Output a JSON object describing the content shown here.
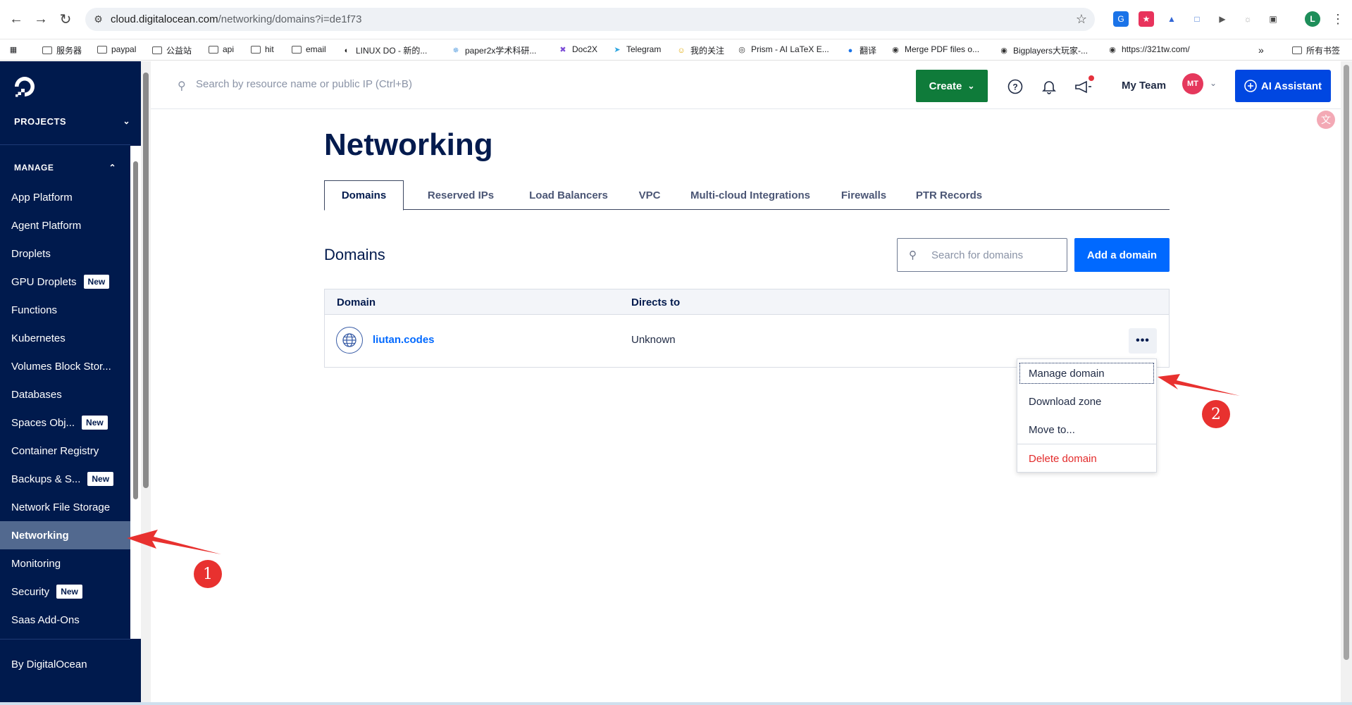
{
  "browser": {
    "url_host": "cloud.digitalocean.com",
    "url_path": "/networking/domains?i=de1f73",
    "bookmarks": [
      "服务器",
      "paypal",
      "公益站",
      "api",
      "hit",
      "email",
      "LINUX DO - 新的...",
      "paper2x学术科研...",
      "Doc2X",
      "Telegram",
      "我的关注",
      "Prism - AI LaTeX E...",
      "翻译",
      "Merge PDF files o...",
      "Bigplayers大玩家-...",
      "https://321tw.com/"
    ],
    "all_bookmarks": "所有书签",
    "more_bookmarks": "»",
    "profile_initial": "L"
  },
  "sidebar": {
    "projects_label": "PROJECTS",
    "manage_label": "MANAGE",
    "items": [
      {
        "label": "App Platform",
        "badge": ""
      },
      {
        "label": "Agent Platform",
        "badge": ""
      },
      {
        "label": "Droplets",
        "badge": ""
      },
      {
        "label": "GPU Droplets",
        "badge": "New"
      },
      {
        "label": "Functions",
        "badge": ""
      },
      {
        "label": "Kubernetes",
        "badge": ""
      },
      {
        "label": "Volumes Block Stor...",
        "badge": ""
      },
      {
        "label": "Databases",
        "badge": ""
      },
      {
        "label": "Spaces Obj...",
        "badge": "New"
      },
      {
        "label": "Container Registry",
        "badge": ""
      },
      {
        "label": "Backups & S...",
        "badge": "New"
      },
      {
        "label": "Network File Storage",
        "badge": ""
      },
      {
        "label": "Networking",
        "badge": "",
        "active": true
      },
      {
        "label": "Monitoring",
        "badge": ""
      },
      {
        "label": "Security",
        "badge": "New"
      },
      {
        "label": "Saas Add-Ons",
        "badge": ""
      }
    ],
    "footer_label": "By DigitalOcean"
  },
  "header": {
    "search_placeholder": "Search by resource name or public IP (Ctrl+B)",
    "create_label": "Create",
    "team_label": "My Team",
    "avatar_initials": "MT",
    "ai_label": "AI Assistant"
  },
  "page": {
    "title": "Networking",
    "tabs": [
      "Domains",
      "Reserved IPs",
      "Load Balancers",
      "VPC",
      "Multi-cloud Integrations",
      "Firewalls",
      "PTR Records"
    ],
    "active_tab": "Domains",
    "section_title": "Domains",
    "domain_search_placeholder": "Search for domains",
    "add_domain_label": "Add a domain"
  },
  "table": {
    "columns": [
      "Domain",
      "Directs to"
    ],
    "rows": [
      {
        "domain": "liutan.codes",
        "directs_to": "Unknown"
      }
    ]
  },
  "menu": {
    "items": [
      "Manage domain",
      "Download zone",
      "Move to...",
      "Delete domain"
    ]
  },
  "annotations": {
    "marker_1": "1",
    "marker_2": "2"
  },
  "colors": {
    "sidebar_bg": "#001a4d",
    "create_green": "#0f7b3a",
    "primary_blue": "#0069ff",
    "danger_red": "#e32b2b",
    "marker_red": "#e8312f"
  }
}
